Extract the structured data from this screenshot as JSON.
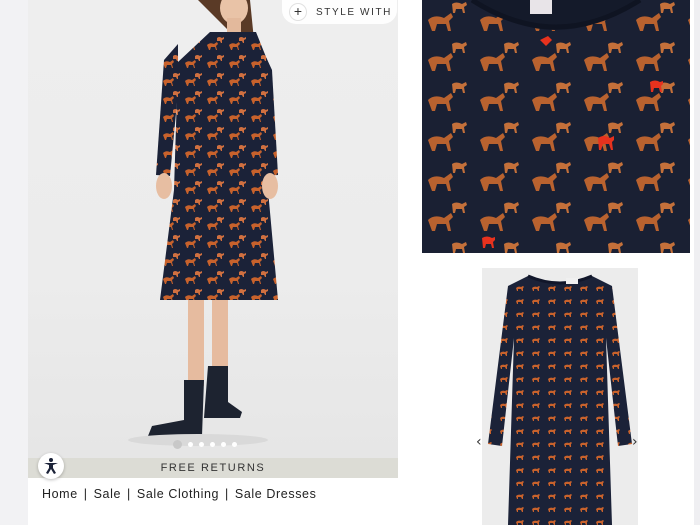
{
  "style_with": {
    "label": "STYLE WITH",
    "icon": "plus-icon"
  },
  "promo": {
    "returns_label": "FREE RETURNS",
    "accessibility_icon": "accessibility-icon"
  },
  "carousel": {
    "dot_count": 6,
    "active_index": 0,
    "prev_icon": "‹",
    "next_icon": "›"
  },
  "breadcrumb": {
    "items": [
      "Home",
      "Sale",
      "Sale Clothing",
      "Sale Dresses"
    ],
    "separator": "|"
  },
  "colors": {
    "dress_navy": "#1b2238",
    "print_orange": "#c8622c",
    "print_red": "#e8321e",
    "returns_bar": "#dcdcd5"
  }
}
